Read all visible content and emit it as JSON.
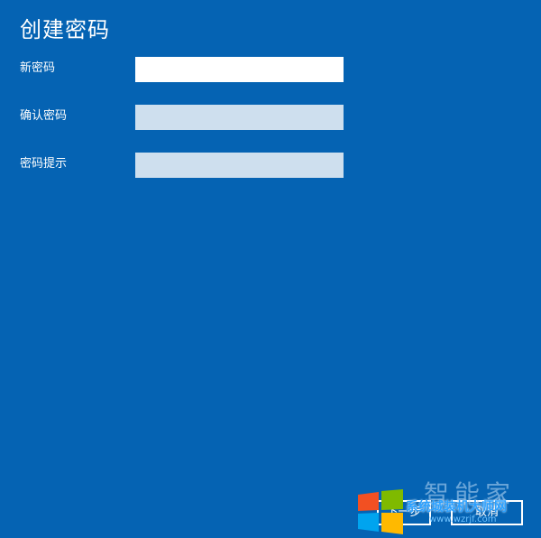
{
  "page": {
    "title": "创建密码"
  },
  "form": {
    "new_password": {
      "label": "新密码",
      "value": "",
      "placeholder": ""
    },
    "confirm_password": {
      "label": "确认密码",
      "value": "",
      "placeholder": ""
    },
    "password_hint": {
      "label": "密码提示",
      "value": "",
      "placeholder": ""
    }
  },
  "footer": {
    "next_label": "下一步",
    "cancel_label": "取消"
  },
  "watermark": {
    "brand": "智能家",
    "site_name": "系统城装机大师网",
    "url": "www.wzrjf.com",
    "logo_icon": "windows-logo-icon",
    "logo_colors": [
      "#f25022",
      "#7fba00",
      "#00a4ef",
      "#ffb900"
    ]
  },
  "colors": {
    "background": "#0563b3",
    "field_active": "#ffffff",
    "field_inactive": "#cedfee"
  }
}
